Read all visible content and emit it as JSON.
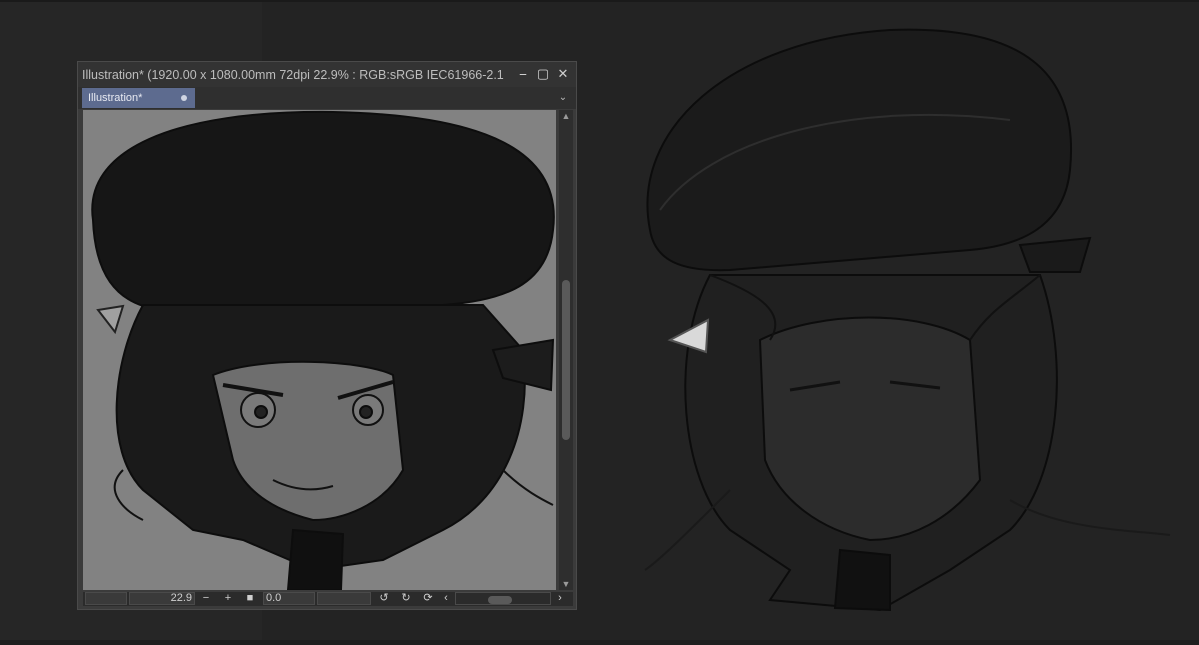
{
  "window": {
    "title": "Illustration* (1920.00 x 1080.00mm 72dpi 22.9% : RGB:sRGB IEC61966-2.1",
    "minimize_icon": "minimize-icon",
    "maximize_icon": "maximize-icon",
    "close_icon": "close-icon"
  },
  "tab": {
    "label": "Illustration*",
    "modified_dot_icon": "unsaved-dot-icon",
    "menu_icon": "chevron-down-icon"
  },
  "statusbar": {
    "zoom_value": "22.9",
    "zoom_out_icon": "minus-icon",
    "zoom_in_icon": "plus-icon",
    "fit_icon": "square-icon",
    "angle_value": "0.0",
    "rotate_left_icon": "rotate-left-icon",
    "rotate_right_icon": "rotate-right-icon",
    "reset_rotation_icon": "reset-rotation-icon",
    "scroll_left_icon": "chevron-left-icon",
    "scroll_right_icon": "chevron-right-icon"
  },
  "colors": {
    "tab_active": "#5d6b8f",
    "canvas_bg": "#828282",
    "workspace": "#232323"
  }
}
